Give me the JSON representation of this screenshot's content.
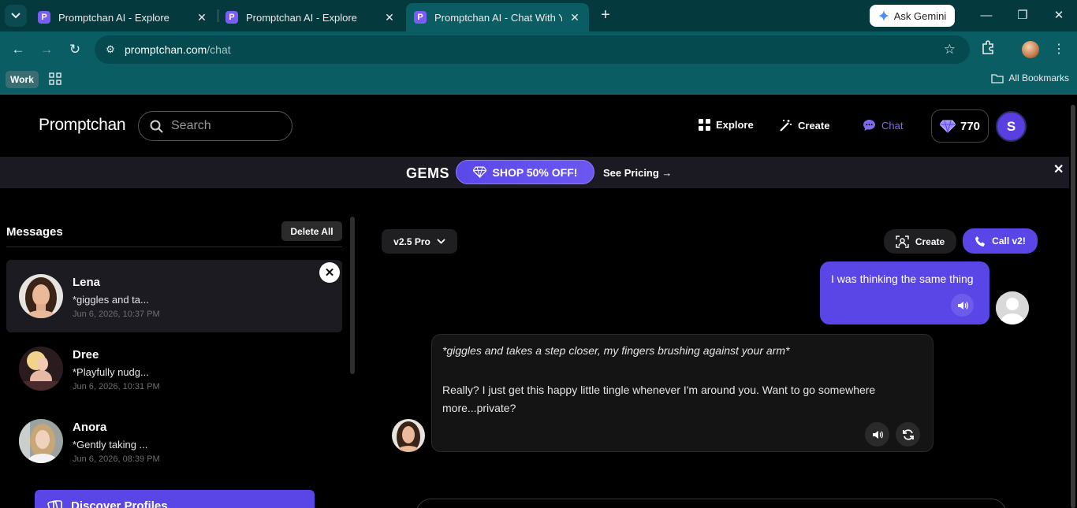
{
  "browser": {
    "tabs": [
      {
        "title": "Promptchan AI - Explore",
        "favicon": "P"
      },
      {
        "title": "Promptchan AI - Explore",
        "favicon": "P"
      },
      {
        "title": "Promptchan AI - Chat With Your",
        "favicon": "P"
      }
    ],
    "gemini_label": "Ask Gemini",
    "url_host": "promptchan.com",
    "url_path": "/chat",
    "bookmarks": {
      "work_label": "Work",
      "all_bookmarks_label": "All Bookmarks"
    }
  },
  "header": {
    "logo": "Promptchan",
    "search_placeholder": "Search",
    "nav": {
      "explore": "Explore",
      "create": "Create",
      "chat": "Chat"
    },
    "gems_count": "770",
    "avatar_initial": "S"
  },
  "promo": {
    "gems_label": "GEMS",
    "shop_label": "SHOP 50% OFF!",
    "pricing_label": "See Pricing →"
  },
  "sidebar": {
    "title": "Messages",
    "delete_all": "Delete All",
    "conversations": [
      {
        "name": "Lena",
        "preview": "*giggles and ta...",
        "time": "Jun 6, 2026, 10:37 PM"
      },
      {
        "name": "Dree",
        "preview": "*Playfully nudg...",
        "time": "Jun 6, 2026, 10:31 PM"
      },
      {
        "name": "Anora",
        "preview": "*Gently taking ...",
        "time": "Jun 6, 2026, 08:39 PM"
      }
    ],
    "discover_label": "Discover Profiles"
  },
  "chat": {
    "model": "v2.5 Pro",
    "create_label": "Create",
    "call_label": "Call v2!",
    "messages": [
      {
        "from": "user",
        "text": "I was thinking the same thing"
      },
      {
        "from": "bot",
        "action": "*giggles and takes a step closer, my fingers brushing against your arm*",
        "text": "Really? I just get this happy little tingle whenever I'm around you. Want to go somewhere more...private?"
      }
    ]
  },
  "colors": {
    "accent": "#5a45e6",
    "chrome": "#0a5e63",
    "tabstrip": "#04393e"
  }
}
